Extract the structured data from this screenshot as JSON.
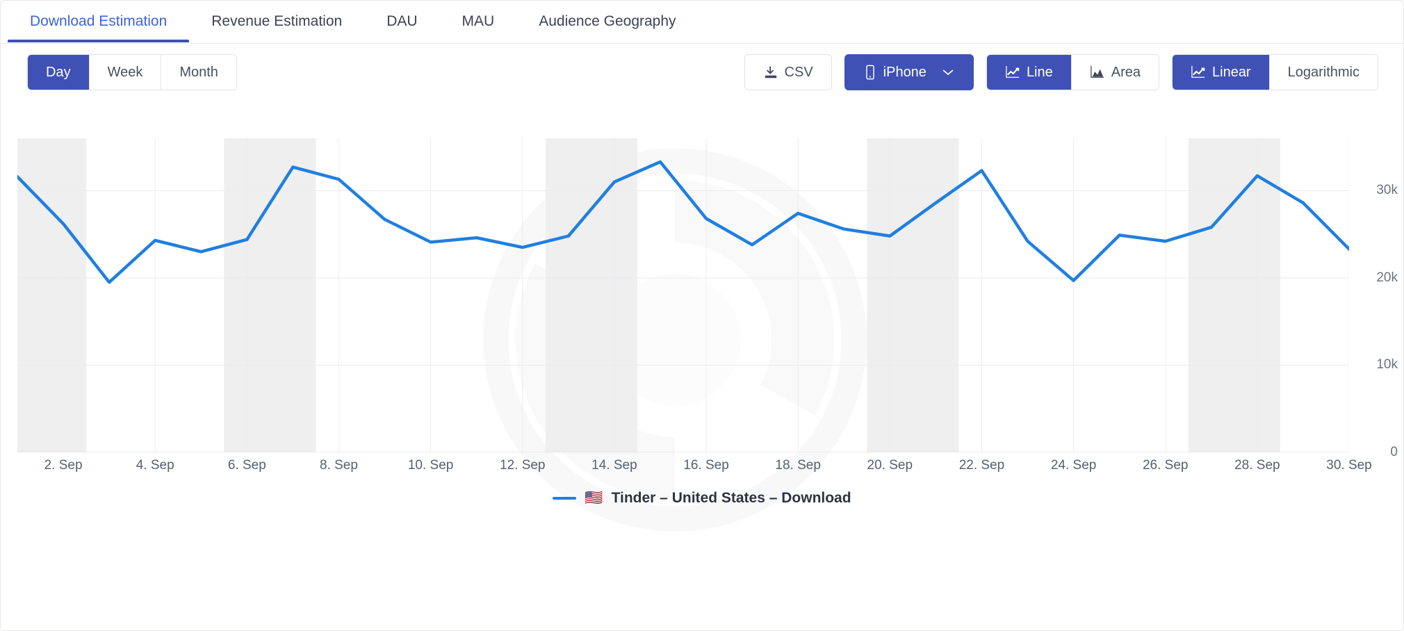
{
  "tabs": [
    {
      "label": "Download Estimation",
      "active": true
    },
    {
      "label": "Revenue Estimation",
      "active": false
    },
    {
      "label": "DAU",
      "active": false
    },
    {
      "label": "MAU",
      "active": false
    },
    {
      "label": "Audience Geography",
      "active": false
    }
  ],
  "toolbar": {
    "granularity": {
      "options": [
        "Day",
        "Week",
        "Month"
      ],
      "selected": "Day",
      "day_label": "Day",
      "week_label": "Week",
      "month_label": "Month"
    },
    "csv_label": "CSV",
    "csv_icon": "download-icon",
    "platform": {
      "label": "iPhone",
      "icon": "phone-icon",
      "chevron": "chevron-down-icon",
      "selected": true
    },
    "chart_type": {
      "line_label": "Line",
      "line_icon": "line-chart-icon",
      "area_label": "Area",
      "area_icon": "area-chart-icon",
      "selected": "Line"
    },
    "scale": {
      "linear_label": "Linear",
      "linear_icon": "line-chart-icon",
      "log_label": "Logarithmic",
      "selected": "Linear"
    }
  },
  "colors": {
    "primary": "#3f51b5",
    "series_line": "#1f7fe0",
    "active_tab_text": "#3e63dd",
    "weekend_band": "#efefef"
  },
  "legend": {
    "flag": "🇺🇸",
    "label": "Tinder – United States – Download"
  },
  "chart_data": {
    "type": "line",
    "title": "",
    "xlabel": "",
    "ylabel": "",
    "ylim": [
      0,
      36000
    ],
    "grid": true,
    "legend_position": "bottom",
    "y_ticks": [
      0,
      10000,
      20000,
      30000
    ],
    "y_tick_labels": [
      "0",
      "10k",
      "20k",
      "30k"
    ],
    "x_tick_labels": [
      "2. Sep",
      "4. Sep",
      "6. Sep",
      "8. Sep",
      "10. Sep",
      "12. Sep",
      "14. Sep",
      "16. Sep",
      "18. Sep",
      "20. Sep",
      "22. Sep",
      "24. Sep",
      "26. Sep",
      "28. Sep",
      "30. Sep"
    ],
    "x": [
      "1. Sep",
      "2. Sep",
      "3. Sep",
      "4. Sep",
      "5. Sep",
      "6. Sep",
      "7. Sep",
      "8. Sep",
      "9. Sep",
      "10. Sep",
      "11. Sep",
      "12. Sep",
      "13. Sep",
      "14. Sep",
      "15. Sep",
      "16. Sep",
      "17. Sep",
      "18. Sep",
      "19. Sep",
      "20. Sep",
      "21. Sep",
      "22. Sep",
      "23. Sep",
      "24. Sep",
      "25. Sep",
      "26. Sep",
      "27. Sep",
      "28. Sep",
      "29. Sep",
      "30. Sep"
    ],
    "weekend_bands": [
      [
        0,
        1
      ],
      [
        5,
        6
      ],
      [
        12,
        13
      ],
      [
        19,
        20
      ],
      [
        26,
        27
      ]
    ],
    "series": [
      {
        "name": "Tinder – United States – Download",
        "color": "#1f7fe0",
        "values": [
          31600,
          26200,
          19500,
          24300,
          23000,
          24400,
          32700,
          31300,
          26700,
          24100,
          24600,
          23500,
          24800,
          31000,
          33300,
          26800,
          23800,
          27400,
          25600,
          24800,
          28600,
          32300,
          24200,
          19700,
          24900,
          24200,
          25800,
          31700,
          28600,
          23300
        ]
      }
    ]
  }
}
